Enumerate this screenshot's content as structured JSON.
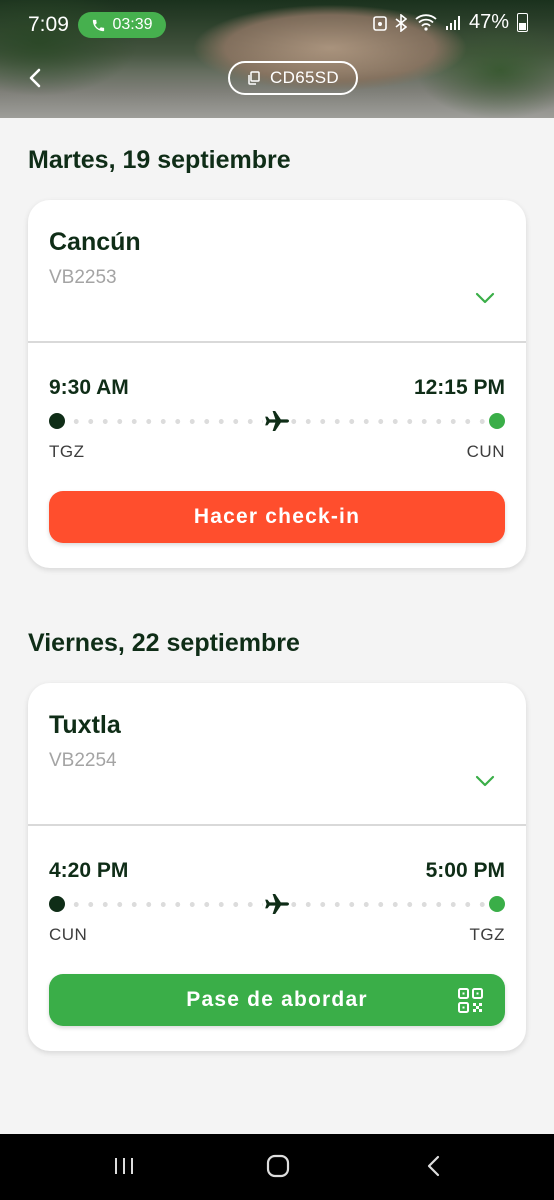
{
  "status_bar": {
    "time": "7:09",
    "call_duration": "03:39",
    "battery_percent": "47%"
  },
  "header": {
    "booking_code": "CD65SD"
  },
  "itinerary": [
    {
      "day_label": "Martes, 19 septiembre",
      "destination": "Cancún",
      "flight_number": "VB2253",
      "departure_time": "9:30 AM",
      "arrival_time": "12:15 PM",
      "origin_code": "TGZ",
      "destination_code": "CUN",
      "action_label": "Hacer check-in",
      "action_color": "#ff4e2d"
    },
    {
      "day_label": "Viernes, 22 septiembre",
      "destination": "Tuxtla",
      "flight_number": "VB2254",
      "departure_time": "4:20 PM",
      "arrival_time": "5:00 PM",
      "origin_code": "CUN",
      "destination_code": "TGZ",
      "action_label": "Pase de abordar",
      "action_color": "#3aae48"
    }
  ],
  "colors": {
    "brand_dark_green": "#0f2d17",
    "brand_green": "#3aae48",
    "accent_orange": "#ff4e2d"
  },
  "icons": [
    "back-arrow-icon",
    "copy-icon",
    "chevron-down-icon",
    "airplane-icon",
    "qr-code-icon",
    "phone-icon",
    "bluetooth-icon",
    "wifi-icon",
    "signal-icon",
    "battery-icon"
  ]
}
